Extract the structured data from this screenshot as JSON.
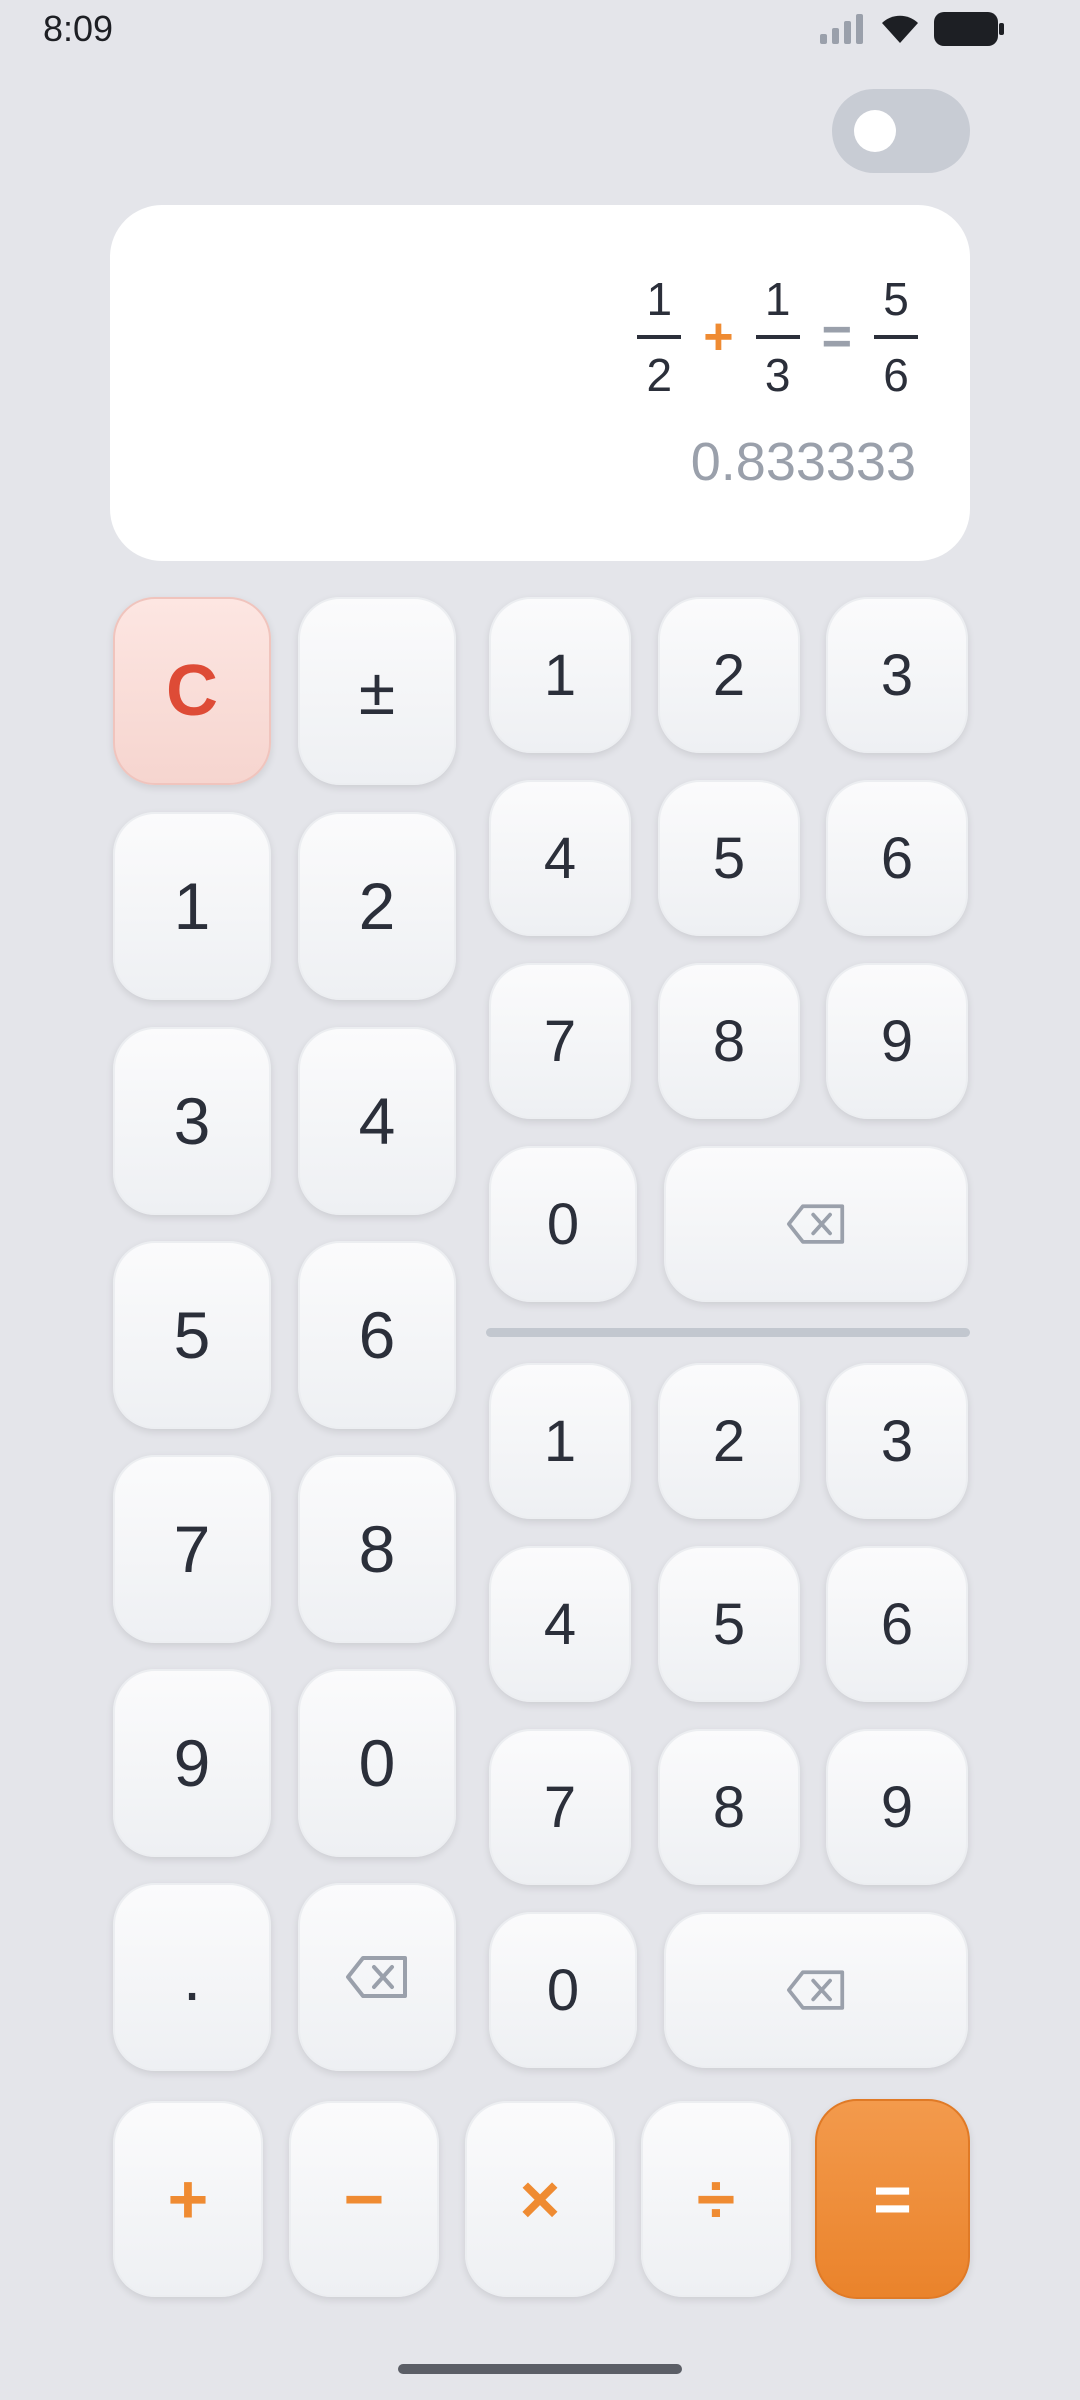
{
  "status": {
    "time": "8:09"
  },
  "display": {
    "fraction1": {
      "num": "1",
      "den": "2"
    },
    "operator": "+",
    "fraction2": {
      "num": "1",
      "den": "3"
    },
    "equals": "=",
    "result": {
      "num": "5",
      "den": "6"
    },
    "decimal": "0.833333"
  },
  "left_keys": {
    "clear": "C",
    "plus_minus": "±",
    "k1": "1",
    "k2": "2",
    "k3": "3",
    "k4": "4",
    "k5": "5",
    "k6": "6",
    "k7": "7",
    "k8": "8",
    "k9": "9",
    "k0": "0",
    "dot": "."
  },
  "numerator_keys": {
    "k1": "1",
    "k2": "2",
    "k3": "3",
    "k4": "4",
    "k5": "5",
    "k6": "6",
    "k7": "7",
    "k8": "8",
    "k9": "9",
    "k0": "0"
  },
  "denominator_keys": {
    "k1": "1",
    "k2": "2",
    "k3": "3",
    "k4": "4",
    "k5": "5",
    "k6": "6",
    "k7": "7",
    "k8": "8",
    "k9": "9",
    "k0": "0"
  },
  "operators": {
    "add": "+",
    "subtract": "−",
    "multiply": "×",
    "divide": "÷",
    "equals": "="
  },
  "toggle": {
    "state": "off"
  },
  "colors": {
    "accent": "#ef8b32",
    "clear": "#de4b36",
    "background": "#e4e5ea"
  },
  "icons": [
    "signal-icon",
    "wifi-icon",
    "battery-icon",
    "backspace-icon"
  ]
}
